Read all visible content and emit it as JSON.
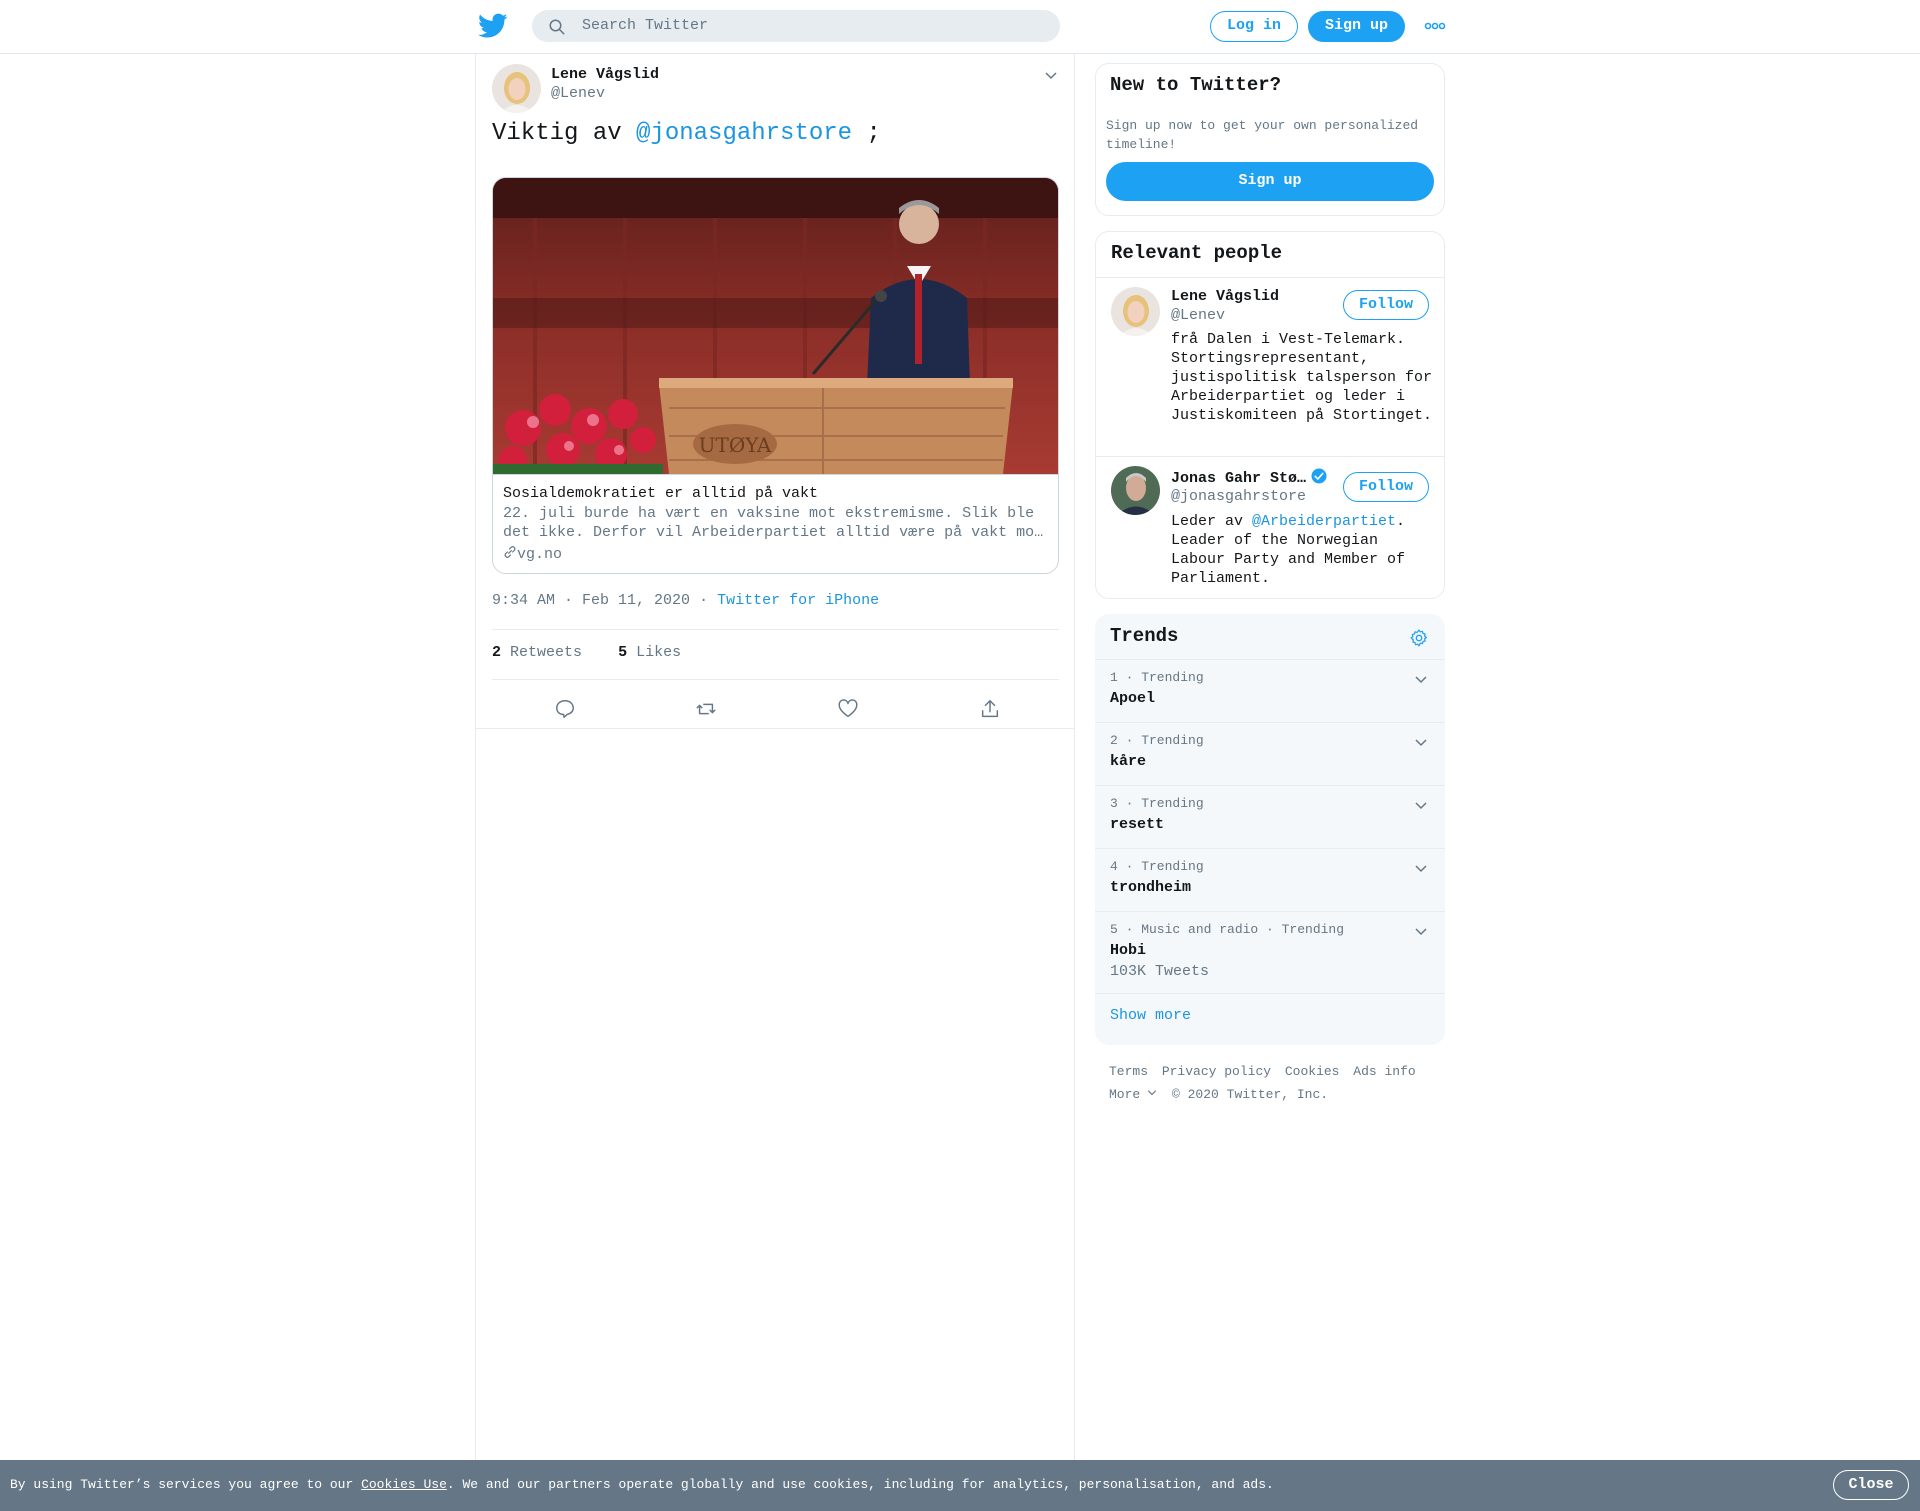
{
  "topbar": {
    "search_placeholder": "Search Twitter",
    "login_label": "Log in",
    "signup_label": "Sign up"
  },
  "tweet": {
    "author_name": "Lene Vågslid",
    "author_handle": "@Lenev",
    "text_prefix": "Viktig av ",
    "mention": "@jonasgahrstore",
    "text_suffix": " ;",
    "card": {
      "title": "Sosialdemokratiet er alltid på vakt",
      "description": "22. juli burde ha vært en vaksine mot ekstremisme. Slik ble det ikke. Derfor vil Arbeiderpartiet alltid være på vakt mo…",
      "domain": "vg.no",
      "image_sign_text": "UTØYA"
    },
    "time": "9:34 AM · Feb 11, 2020",
    "meta_separator": "·",
    "source": "Twitter for iPhone",
    "retweets_count": "2",
    "retweets_label": "Retweets",
    "likes_count": "5",
    "likes_label": "Likes"
  },
  "sidebar": {
    "new_to_twitter": {
      "title": "New to Twitter?",
      "subtitle": "Sign up now to get your own personalized timeline!",
      "button": "Sign up"
    },
    "relevant_people": {
      "title": "Relevant people",
      "people": [
        {
          "name": "Lene Vågslid",
          "handle": "@Lenev",
          "follow_label": "Follow",
          "bio": "frå Dalen i Vest-Telemark. Stortingsrepresentant, justispolitisk talsperson for Arbeiderpartiet og leder i Justiskomiteen på Stortinget."
        },
        {
          "name": "Jonas Gahr Stø…",
          "handle": "@jonasgahrstore",
          "follow_label": "Follow",
          "bio_prefix": "Leder av ",
          "bio_mention": "@Arbeiderpartiet",
          "bio_suffix": ". Leader of the Norwegian Labour Party and Member of Parliament."
        }
      ]
    },
    "trends": {
      "title": "Trends",
      "items": [
        {
          "context": "1 · Trending",
          "name": "Apoel",
          "count": ""
        },
        {
          "context": "2 · Trending",
          "name": "kåre",
          "count": ""
        },
        {
          "context": "3 · Trending",
          "name": "resett",
          "count": ""
        },
        {
          "context": "4 · Trending",
          "name": "trondheim",
          "count": ""
        },
        {
          "context": "5 · Music and radio · Trending",
          "name": "Hobi",
          "count": "103K Tweets"
        }
      ],
      "show_more": "Show more"
    },
    "footer": {
      "links": [
        "Terms",
        "Privacy policy",
        "Cookies",
        "Ads info"
      ],
      "more": "More",
      "copyright": "© 2020 Twitter, Inc."
    }
  },
  "cookie_bar": {
    "text_prefix": "By using Twitter’s services you agree to our ",
    "link": "Cookies Use",
    "text_suffix": ". We and our partners operate globally and use cookies, including for analytics, personalisation, and ads.",
    "close_label": "Close"
  },
  "colors": {
    "brand": "#1da1f2",
    "link": "#1b95e0",
    "secondary_text": "#657786",
    "cookie_bar": "#657786"
  }
}
